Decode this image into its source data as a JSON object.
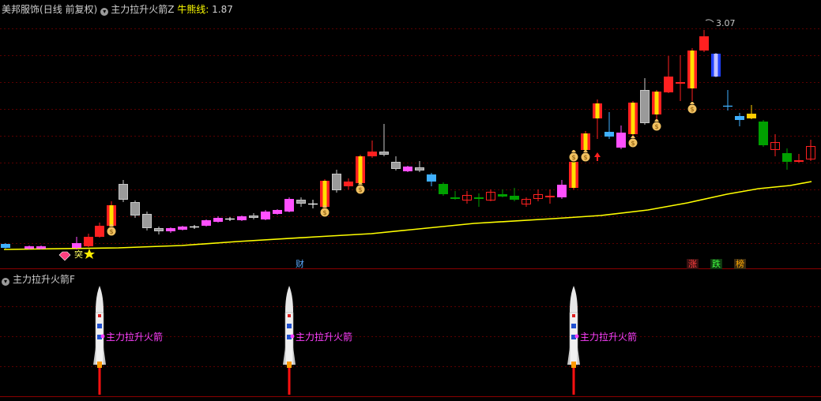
{
  "header": {
    "stock_name": "美邦服饰",
    "period": "(日线 前复权)",
    "indicator": "主力拉升火箭Z",
    "bull_line_label": "牛熊线:",
    "bull_line_value": "1.87"
  },
  "sub_header": {
    "indicator": "主力拉升火箭F"
  },
  "price_high_label": "3.07",
  "event_badges": [
    {
      "text": "财",
      "color": "#5aaaff"
    },
    {
      "text": "涨",
      "color": "#ff4040"
    },
    {
      "text": "跌",
      "color": "#40ff40"
    },
    {
      "text": "榜",
      "color": "#ffaa00"
    }
  ],
  "rocket_label": "主力拉升火箭",
  "start_signal_text": "突",
  "colors": {
    "background": "#000000",
    "bull_line": "#ffff00",
    "grid": "#5a0000",
    "rise": "#ff0000",
    "fall": "#00aa00",
    "magenta": "#ff40ff",
    "rocket_label": "#ff40ff"
  }
}
